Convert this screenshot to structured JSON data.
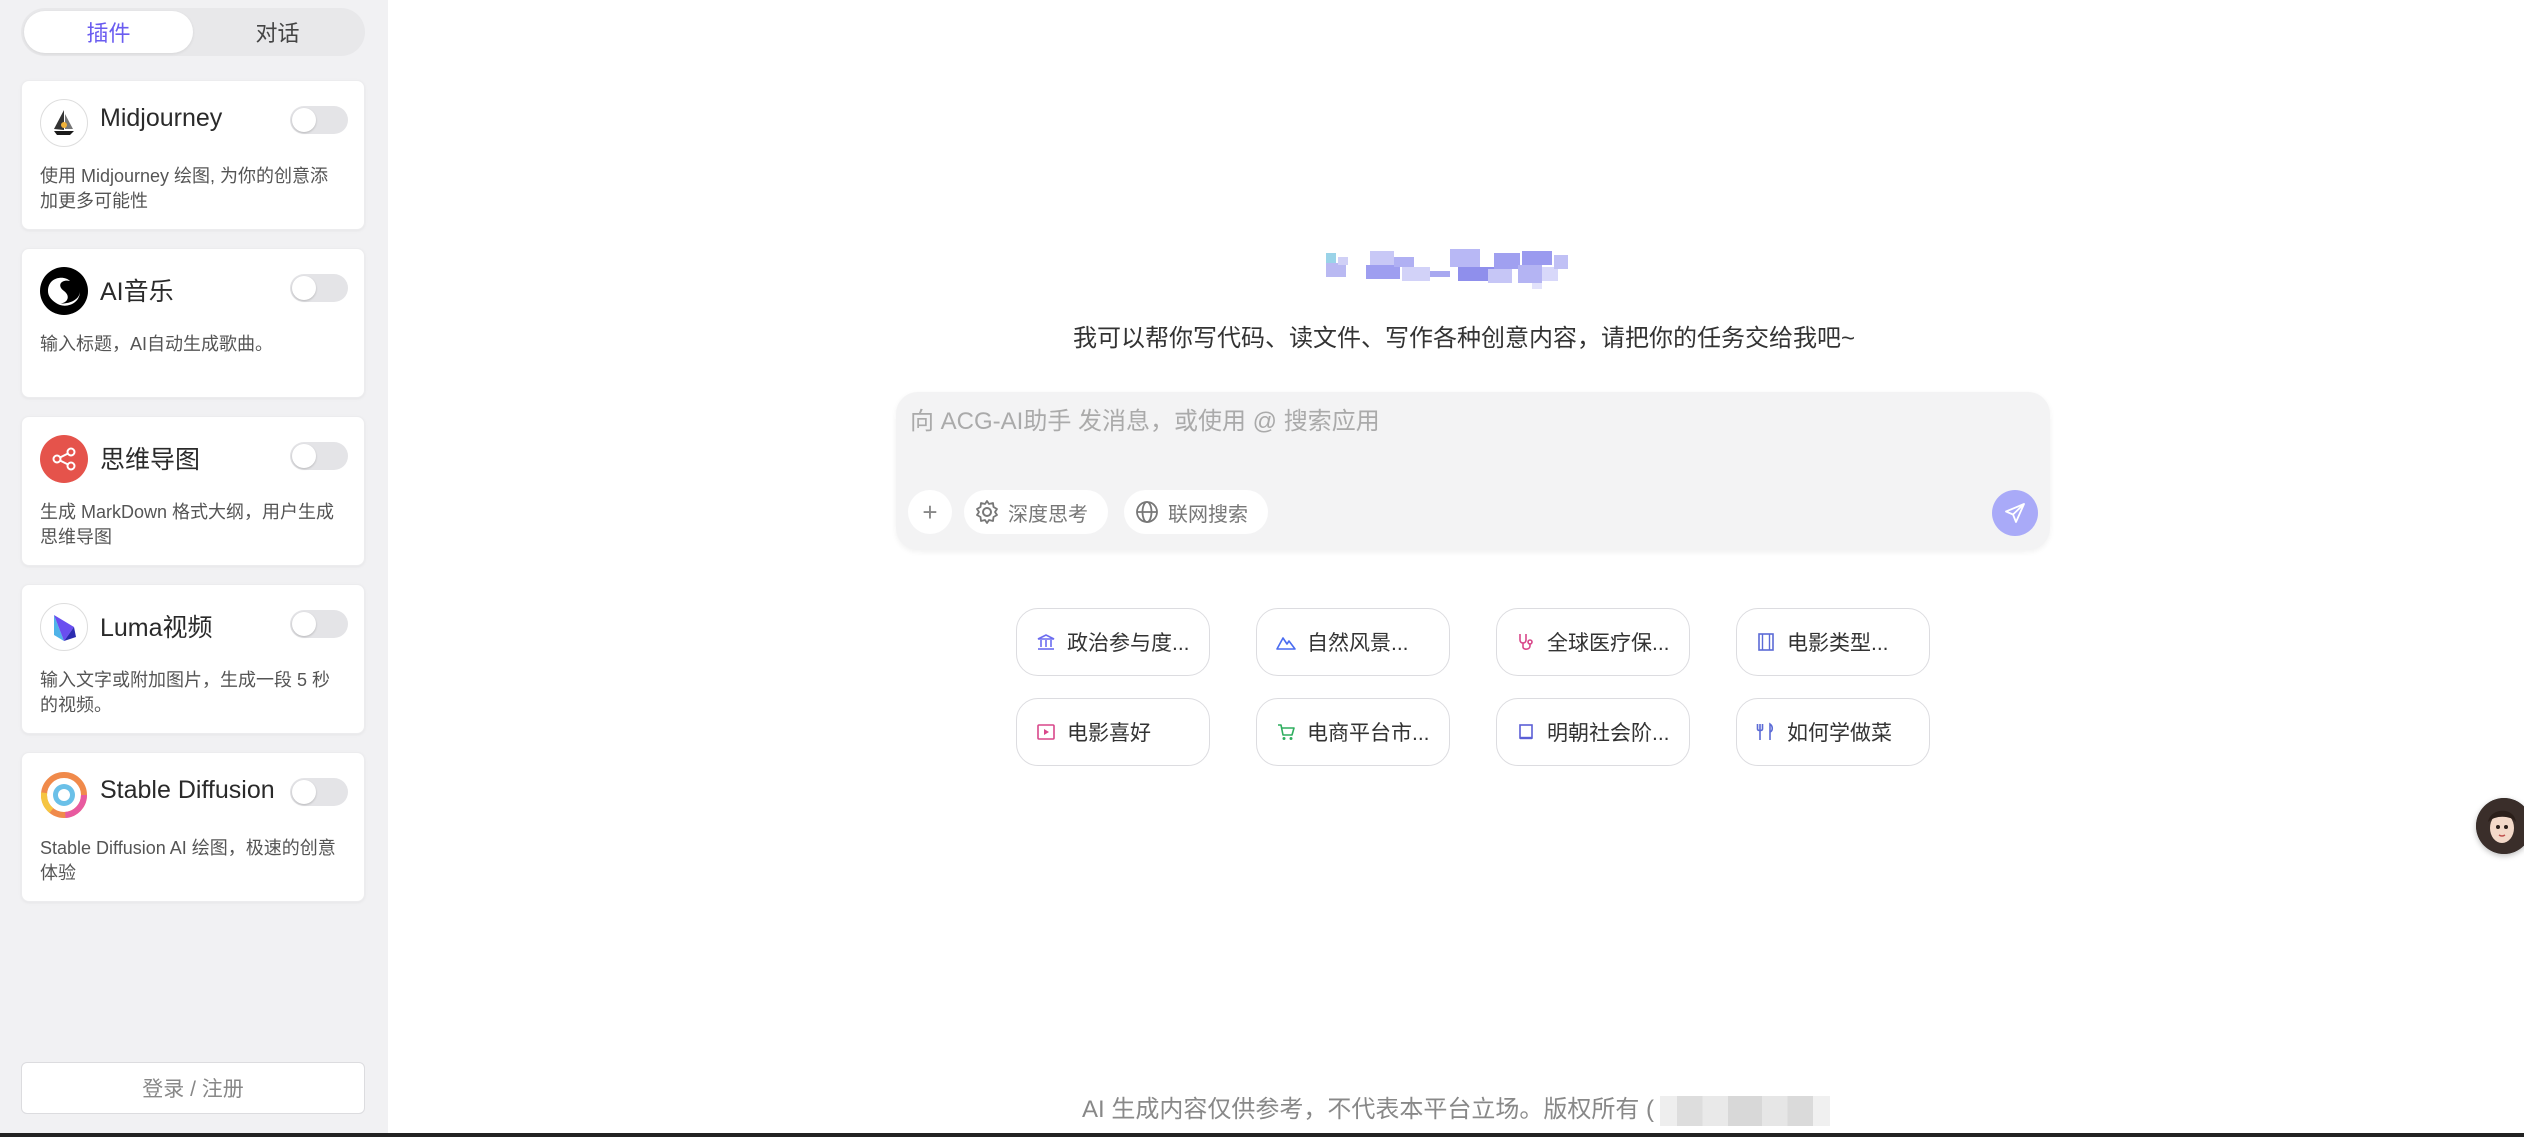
{
  "sidebar": {
    "tabs": [
      {
        "label": "插件",
        "active": true
      },
      {
        "label": "对话",
        "active": false
      }
    ],
    "plugins": [
      {
        "name": "Midjourney",
        "desc": "使用 Midjourney 绘图, 为你的创意添加更多可能性",
        "icon": "midjourney-boat-icon",
        "enabled": false
      },
      {
        "name": "AI音乐",
        "desc": "输入标题，AI自动生成歌曲。",
        "icon": "music-swirl-icon",
        "enabled": false
      },
      {
        "name": "思维导图",
        "desc": "生成 MarkDown 格式大纲，用户生成思维导图",
        "icon": "mindmap-share-icon",
        "enabled": false
      },
      {
        "name": "Luma视频",
        "desc": "输入文字或附加图片，生成一段 5 秒的视频。",
        "icon": "luma-cube-icon",
        "enabled": false
      },
      {
        "name": "Stable Diffusion",
        "desc": "Stable Diffusion AI 绘图，极速的创意体验",
        "icon": "stable-diffusion-ring-icon",
        "enabled": false
      }
    ],
    "login_label": "登录 / 注册"
  },
  "main": {
    "subtitle": "我可以帮你写代码、读文件、写作各种创意内容，请把你的任务交给我吧~",
    "composer": {
      "placeholder": "向 ACG-AI助手 发消息，或使用 @ 搜索应用",
      "deep_think_label": "深度思考",
      "web_search_label": "联网搜索"
    },
    "suggestions": [
      {
        "label": "政治参与度...",
        "icon": "bank-icon",
        "color": "#6b6cf0"
      },
      {
        "label": "自然风景...",
        "icon": "mountain-icon",
        "color": "#4a6cf0"
      },
      {
        "label": "全球医疗保...",
        "icon": "stethoscope-icon",
        "color": "#d9478a"
      },
      {
        "label": "电影类型...",
        "icon": "film-icon",
        "color": "#5b6bd6"
      },
      {
        "label": "电影喜好",
        "icon": "play-square-icon",
        "color": "#d9478a"
      },
      {
        "label": "电商平台市...",
        "icon": "cart-icon",
        "color": "#2fae5f"
      },
      {
        "label": "明朝社会阶...",
        "icon": "book-icon",
        "color": "#5b5fd6"
      },
      {
        "label": "如何学做菜",
        "icon": "utensils-icon",
        "color": "#5b6bd6"
      }
    ],
    "footer": "AI 生成内容仅供参考，不代表本平台立场。版权所有 ("
  },
  "colors": {
    "accent": "#6a5cf0",
    "send_button": "#a9aaf8",
    "sidebar_bg": "#f1f1f3"
  }
}
